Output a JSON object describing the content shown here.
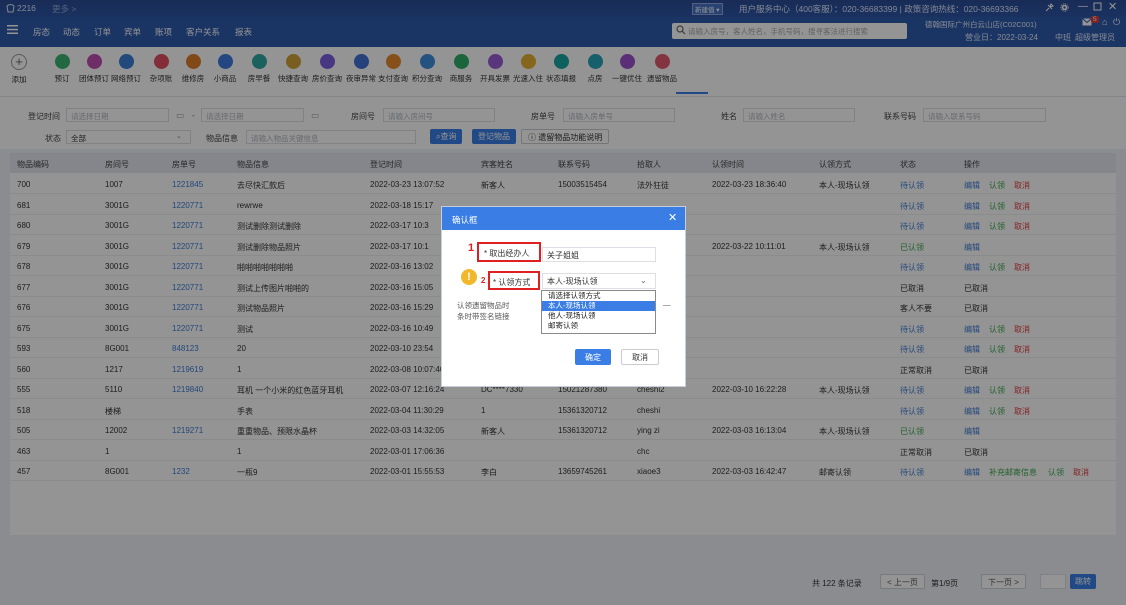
{
  "header": {
    "title": "2216",
    "subtitle": "更多 >",
    "badge": "新建值 ▾",
    "hotline": "用户服务中心（400客服）：020-36683399 | 政策咨询热线：020-36693366",
    "store": "德翰国际广州白云山店(C02C001)",
    "business_day": "营业日：2022-03-24",
    "shift": "中班",
    "role": "超级管理员",
    "notif_count": "5"
  },
  "nav": {
    "items": [
      "房态",
      "动态",
      "订单",
      "宾单",
      "账项",
      "客户关系",
      "报表"
    ]
  },
  "search": {
    "placeholder": "请输入房号，客人姓名，手机号码，搜寻客法进行搜索"
  },
  "toolbar": {
    "add_label": "添加",
    "items": [
      "预订",
      "团体预订",
      "网络预订",
      "杂项账",
      "维修房",
      "小商品",
      "房早餐",
      "快捷查询",
      "房价查询",
      "夜审异常",
      "支付查询",
      "积分查询",
      "商服务",
      "开具发票",
      "光速入住",
      "状态填报",
      "点房",
      "一键优住",
      "遗留物品"
    ],
    "colors": [
      "#3bb36f",
      "#c04fb3",
      "#3a7fd5",
      "#e04f5f",
      "#e07e2a",
      "#3f7be0",
      "#2fa9a3",
      "#d2a33a",
      "#7b5fe1",
      "#4173d6",
      "#e68b2e",
      "#3e8fdc",
      "#2fae6a",
      "#9a5dd6",
      "#e3b233",
      "#18a5a0",
      "#26a6b8",
      "#9b52cf",
      "#e25b6e"
    ]
  },
  "filter": {
    "reg_time_label": "登记时间",
    "start_ph": "请选择日期",
    "end_ph": "请选择日期",
    "room_label": "房间号",
    "room_ph": "请输入房间号",
    "order_label": "房单号",
    "order_ph": "请输入房单号",
    "name_label": "姓名",
    "name_ph": "请输入姓名",
    "phone_label": "联系号码",
    "phone_ph": "请输入联系号码",
    "status_label": "状态",
    "status_value": "全部",
    "item_label": "物品信息",
    "item_ph": "请输入物品关键信息",
    "query_btn": "查询",
    "register_btn": "登记物品",
    "help_btn": "遗留物品功能说明"
  },
  "table": {
    "headers": [
      "物品编码",
      "房间号",
      "房单号",
      "物品信息",
      "登记时间",
      "宾客姓名",
      "联系号码",
      "拾取人",
      "认领时间",
      "认领方式",
      "状态",
      "操作"
    ],
    "rows": [
      [
        "700",
        "1007",
        "1221845",
        "去尽快汇款后",
        "2022-03-23 13:07:52",
        "新客人",
        "15003515454",
        "法外狂徒",
        "2022-03-23 18:36:40",
        "本人-现场认领",
        "待认领",
        "编辑|认领|取消"
      ],
      [
        "681",
        "3001G",
        "1220771",
        "rewrwe",
        "2022-03-18 15:17",
        "",
        "",
        "",
        "",
        "",
        "待认领",
        "编辑|认领|取消"
      ],
      [
        "680",
        "3001G",
        "1220771",
        "测试删除测试删除",
        "2022-03-17 10:3",
        "",
        "",
        "",
        "",
        "",
        "待认领",
        "编辑|认领|取消"
      ],
      [
        "679",
        "3001G",
        "1220771",
        "测试删除物品照片",
        "2022-03-17 10:1",
        "",
        "",
        "",
        "2022-03-22 10:11:01",
        "本人-现场认领",
        "已认领",
        "编辑"
      ],
      [
        "678",
        "3001G",
        "1220771",
        "啪啪啪啪啪啪啪",
        "2022-03-16 13:02",
        "",
        "",
        "",
        "",
        "",
        "待认领",
        "编辑|认领|取消"
      ],
      [
        "677",
        "3001G",
        "1220771",
        "测试上传图片啪啪的",
        "2022-03-16 15:05",
        "",
        "",
        "",
        "",
        "",
        "已取消",
        "已取消"
      ],
      [
        "676",
        "3001G",
        "1220771",
        "测试物品照片",
        "2022-03-16 15:29",
        "",
        "",
        "",
        "",
        "",
        "客人不要",
        "已取消"
      ],
      [
        "675",
        "3001G",
        "1220771",
        "测试",
        "2022-03-16 10:49",
        "",
        "",
        "",
        "",
        "",
        "待认领",
        "编辑|认领|取消"
      ],
      [
        "593",
        "8G001",
        "848123",
        "20",
        "2022-03-10 23:54",
        "",
        "",
        "",
        "",
        "",
        "待认领",
        "编辑|认领|取消"
      ],
      [
        "560",
        "1217",
        "1219619",
        "1",
        "2022-03-08 10:07:40",
        "1",
        "",
        "法治0911",
        "",
        "",
        "正常取消",
        "已取消"
      ],
      [
        "555",
        "5110",
        "1219840",
        "耳机 一个小米的红色蓝牙耳机",
        "2022-03-07 12:16:24",
        "DC****7330",
        "15021287380",
        "cheshi2",
        "2022-03-10 16:22:28",
        "本人-现场认领",
        "待认领",
        "编辑|认领|取消"
      ],
      [
        "518",
        "楼梯",
        "",
        "手表",
        "2022-03-04 11:30:29",
        "1",
        "15361320712",
        "cheshi",
        "",
        "",
        "待认领",
        "编辑|认领|取消"
      ],
      [
        "505",
        "12002",
        "1219271",
        "重重物品、预限水晶杯",
        "2022-03-03 14:32:05",
        "新客人",
        "15361320712",
        "ying zi",
        "2022-03-03 16:13:04",
        "本人-现场认领",
        "已认领",
        "编辑"
      ],
      [
        "463",
        "1",
        "",
        "1",
        "2022-03-01 17:06:36",
        "",
        "",
        "chc",
        "",
        "",
        "正常取消",
        "已取消"
      ],
      [
        "457",
        "8G001",
        "1232",
        "一瓶9",
        "2022-03-01 15:55:53",
        "李白",
        "13659745261",
        "xiaoe3",
        "2022-03-03 16:42:47",
        "邮寄认领",
        "待认领",
        "编辑|补充邮寄信息|认领|取消"
      ]
    ]
  },
  "pagination": {
    "total": "共 122 条记录",
    "prev": "< 上一页",
    "page": "第1/9页",
    "next": "下一页 >",
    "go": "跳转"
  },
  "dialog": {
    "title": "确认框",
    "number1": "1",
    "number2": "2",
    "pickup_label": "* 取出经办人",
    "pickup_value": "关子姐姐",
    "method_label": "* 认领方式",
    "method_value": "本人-现场认领",
    "options": [
      "请选择认领方式",
      "本人-现场认领",
      "他人-现场认领",
      "邮寄认领"
    ],
    "hidden_text1": "认领遗留物品时",
    "hidden_text1_tail": "—",
    "hidden_text2": "条时带签名链接",
    "confirm": "确定",
    "cancel": "取消"
  }
}
